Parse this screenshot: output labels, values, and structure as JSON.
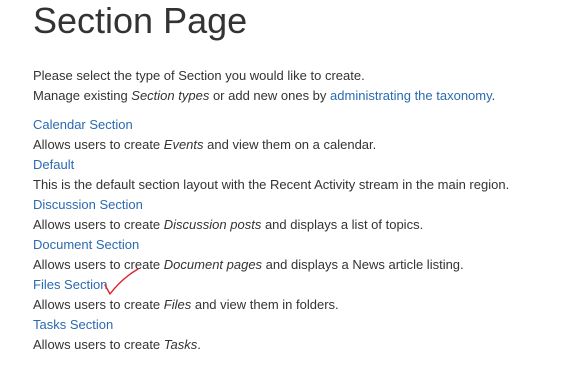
{
  "page": {
    "title": "Section Page",
    "intro_line1": "Please select the type of Section you would like to create.",
    "intro_line2_prefix": "Manage existing ",
    "intro_line2_em": "Section types",
    "intro_line2_mid": " or add new ones by ",
    "intro_line2_link": "administrating the taxonomy",
    "intro_line2_suffix": "."
  },
  "section_types": [
    {
      "title": "Calendar Section",
      "desc_prefix": "Allows users to create ",
      "desc_em": "Events",
      "desc_suffix": " and view them on a calendar."
    },
    {
      "title": "Default",
      "desc_prefix": "This is the default section layout with the Recent Activity stream in the main region.",
      "desc_em": "",
      "desc_suffix": ""
    },
    {
      "title": "Discussion Section",
      "desc_prefix": "Allows users to create ",
      "desc_em": "Discussion posts",
      "desc_suffix": " and displays a list of topics."
    },
    {
      "title": "Document Section",
      "desc_prefix": "Allows users to create ",
      "desc_em": "Document pages",
      "desc_suffix": " and displays a News article listing."
    },
    {
      "title": "Files Section",
      "desc_prefix": "Allows users to create ",
      "desc_em": "Files",
      "desc_suffix": " and view them in folders."
    },
    {
      "title": "Tasks Section",
      "desc_prefix": "Allows users to create ",
      "desc_em": "Tasks",
      "desc_suffix": "."
    }
  ],
  "annotation": {
    "icon": "checkmark-icon",
    "color": "#e0202a"
  },
  "colors": {
    "text": "#333333",
    "link": "#2a6ab0"
  }
}
